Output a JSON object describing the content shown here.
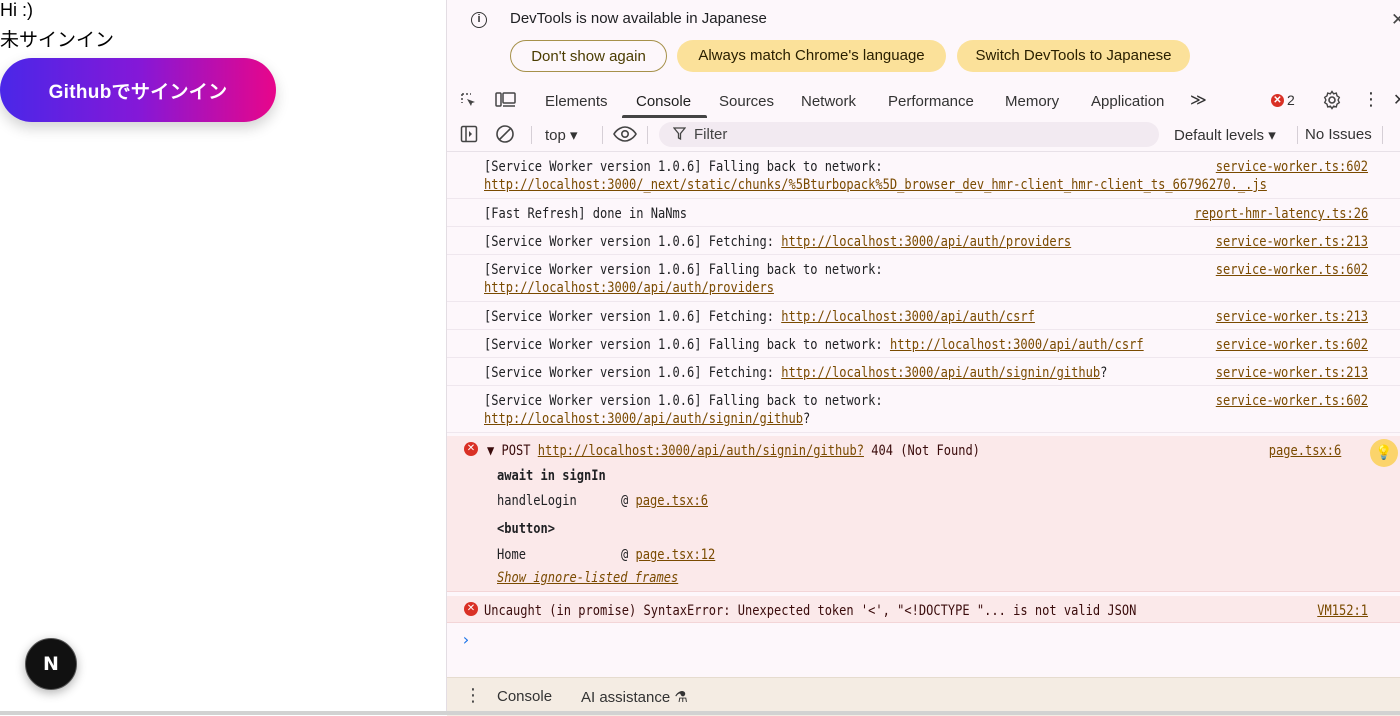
{
  "page": {
    "greeting": "Hi :)",
    "status": "未サインイン",
    "signin_button": "Githubでサインイン",
    "nextjs_badge": "N"
  },
  "devtools": {
    "infobar": {
      "message": "DevTools is now available in Japanese",
      "buttons": [
        "Don't show again",
        "Always match Chrome's language",
        "Switch DevTools to Japanese"
      ],
      "close": "✕"
    },
    "tabs": [
      "Elements",
      "Console",
      "Sources",
      "Network",
      "Performance",
      "Memory",
      "Application"
    ],
    "more_tabs": "≫",
    "error_count": "2",
    "toolbar": {
      "context": "top ▾",
      "filter_placeholder": "Filter",
      "levels": "Default levels ▾",
      "issues": "No Issues"
    },
    "logs": [
      {
        "text": "[Service Worker version 1.0.6] Falling back to network:",
        "url": "http://localhost:3000/_next/static/chunks/%5Bturbopack%5D_browser_dev_hmr-client_hmr-client_ts_66796270._.js",
        "source": "service-worker.ts:602"
      },
      {
        "text": "[Fast Refresh] done in NaNms",
        "source": "report-hmr-latency.ts:26"
      },
      {
        "text": "[Service Worker version 1.0.6] Fetching:",
        "url": "http://localhost:3000/api/auth/providers",
        "source": "service-worker.ts:213"
      },
      {
        "text": "[Service Worker version 1.0.6] Falling back to network:",
        "url": "http://localhost:3000/api/auth/providers",
        "source": "service-worker.ts:602"
      },
      {
        "text": "[Service Worker version 1.0.6] Fetching:",
        "url": "http://localhost:3000/api/auth/csrf",
        "source": "service-worker.ts:213"
      },
      {
        "text": "[Service Worker version 1.0.6] Falling back to network:",
        "url": "http://localhost:3000/api/auth/csrf",
        "source": "service-worker.ts:602"
      },
      {
        "text": "[Service Worker version 1.0.6] Fetching:",
        "url": "http://localhost:3000/api/auth/signin/github",
        "suffix": "?",
        "source": "service-worker.ts:213"
      },
      {
        "text": "[Service Worker version 1.0.6] Falling back to network:",
        "url": "http://localhost:3000/api/auth/signin/github",
        "suffix": "?",
        "source": "service-worker.ts:602"
      }
    ],
    "error1": {
      "prefix": "▼ POST",
      "url": "http://localhost:3000/api/auth/signin/github?",
      "status": "404 (Not Found)",
      "source": "page.tsx:6",
      "stack": [
        {
          "label": "await in signIn"
        },
        {
          "label": "handleLogin",
          "at": "@",
          "link": "page.tsx:6"
        },
        {
          "label": "<button>"
        },
        {
          "label": "Home",
          "at": "@",
          "link": "page.tsx:12"
        }
      ],
      "ignore_frames": "Show ignore-listed frames"
    },
    "error2": {
      "text": "Uncaught (in promise) SyntaxError: Unexpected token '<', \"<!DOCTYPE \"... is not valid JSON",
      "source": "VM152:1"
    },
    "prompt": "›",
    "drawer": {
      "tabs": [
        "Console",
        "AI assistance"
      ],
      "ai_icon": "⚗"
    }
  }
}
